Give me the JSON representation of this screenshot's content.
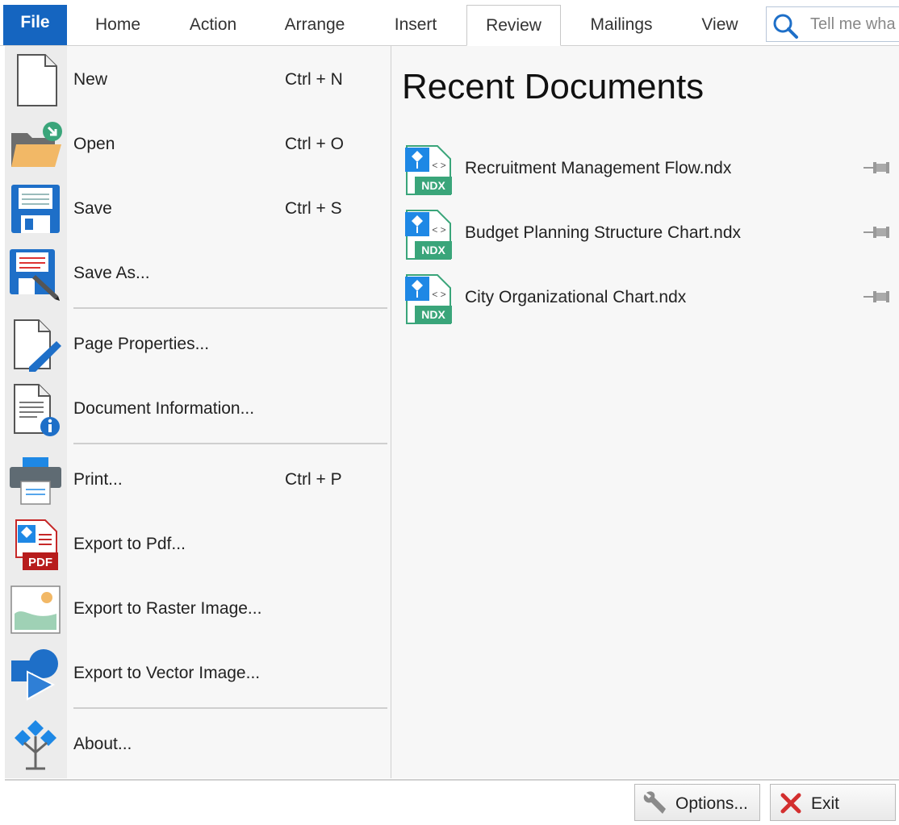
{
  "tabs": {
    "file": "File",
    "home": "Home",
    "action": "Action",
    "arrange": "Arrange",
    "insert": "Insert",
    "review": "Review",
    "mailings": "Mailings",
    "view": "View"
  },
  "search": {
    "placeholder": "Tell me wha"
  },
  "menu": {
    "new": {
      "label": "New",
      "shortcut": "Ctrl + N"
    },
    "open": {
      "label": "Open",
      "shortcut": "Ctrl + O"
    },
    "save": {
      "label": "Save",
      "shortcut": "Ctrl + S"
    },
    "save_as": {
      "label": "Save As..."
    },
    "page_properties": {
      "label": "Page Properties..."
    },
    "document_information": {
      "label": "Document Information..."
    },
    "print": {
      "label": "Print...",
      "shortcut": "Ctrl + P"
    },
    "export_pdf": {
      "label": "Export to Pdf..."
    },
    "export_raster": {
      "label": "Export to Raster Image..."
    },
    "export_vector": {
      "label": "Export to Vector Image..."
    },
    "about": {
      "label": "About..."
    }
  },
  "recent": {
    "title": "Recent Documents",
    "badge": "NDX",
    "documents": [
      {
        "name": "Recruitment Management Flow.ndx"
      },
      {
        "name": "Budget Planning Structure Chart.ndx"
      },
      {
        "name": "City Organizational Chart.ndx"
      }
    ]
  },
  "pdf_badge": "PDF",
  "footer": {
    "options": "Options...",
    "exit": "Exit"
  },
  "colors": {
    "file_tab": "#1565c0",
    "ndx_green": "#3aa57a",
    "ndx_blue": "#1e88e5",
    "exit_red": "#d32f2f"
  }
}
